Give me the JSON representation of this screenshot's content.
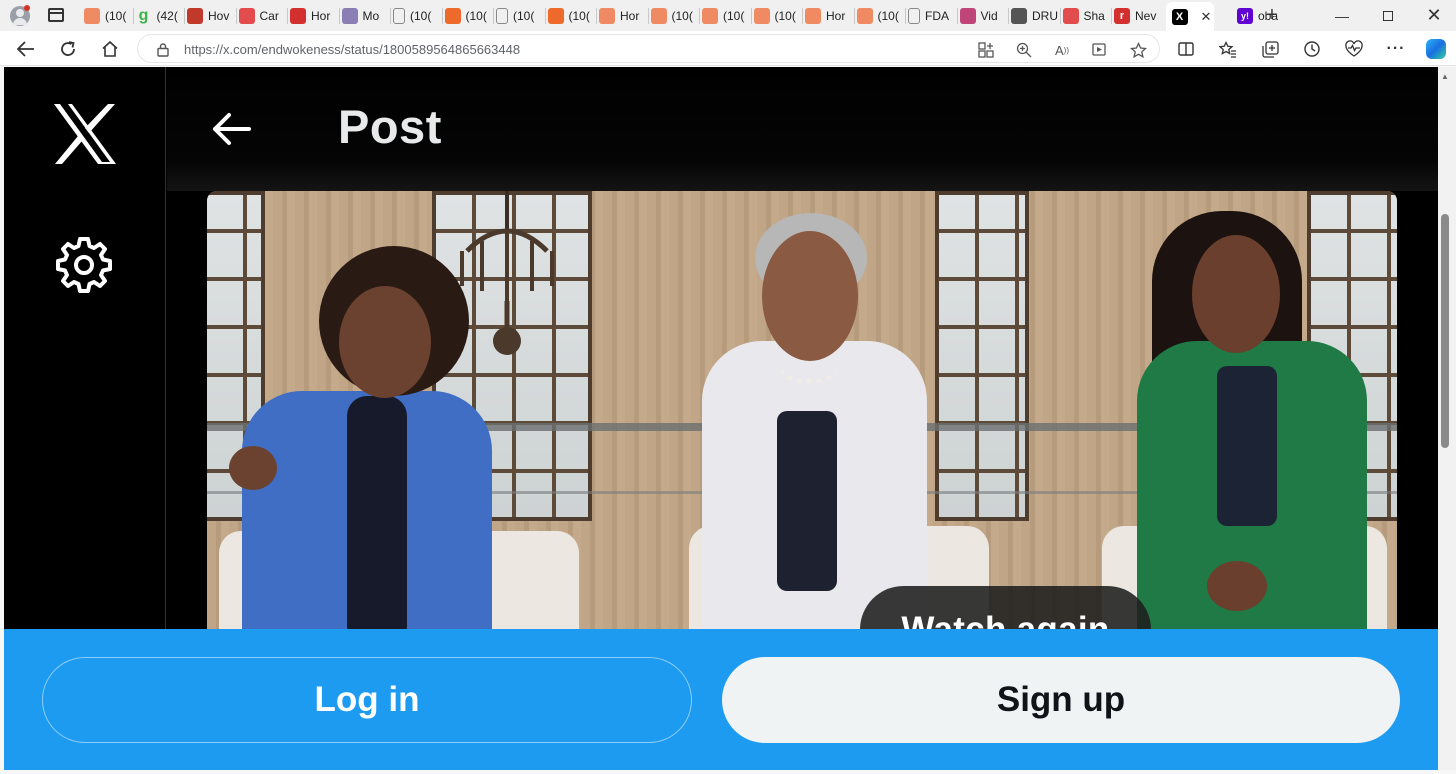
{
  "browser": {
    "tabs": [
      {
        "label": "(10(",
        "icon": "substack-icon",
        "color": "#f08a62"
      },
      {
        "label": "(42(",
        "icon": "green-g-icon",
        "color": "#3bb54a"
      },
      {
        "label": "Hov",
        "icon": "bi-icon",
        "color": "#c0392b"
      },
      {
        "label": "Car",
        "icon": "youtube-icon",
        "color": "#e34c4c"
      },
      {
        "label": "Hor",
        "icon": "red-shield-icon",
        "color": "#d32f2f"
      },
      {
        "label": "Mo",
        "icon": "ai-icon",
        "color": "#8a7fb5"
      },
      {
        "label": "(10(",
        "icon": "document-icon",
        "color": "#888888"
      },
      {
        "label": "(10(",
        "icon": "substack-icon",
        "color": "#ee6a2b"
      },
      {
        "label": "(10(",
        "icon": "document-icon",
        "color": "#888888"
      },
      {
        "label": "(10(",
        "icon": "substack-icon",
        "color": "#ee6a2b"
      },
      {
        "label": "Hor",
        "icon": "substack-icon",
        "color": "#f08a62"
      },
      {
        "label": "(10(",
        "icon": "substack-icon",
        "color": "#f08a62"
      },
      {
        "label": "(10(",
        "icon": "substack-icon",
        "color": "#f08a62"
      },
      {
        "label": "(10(",
        "icon": "substack-icon",
        "color": "#f08a62"
      },
      {
        "label": "Hor",
        "icon": "substack-icon",
        "color": "#f08a62"
      },
      {
        "label": "(10(",
        "icon": "substack-icon",
        "color": "#f08a62"
      },
      {
        "label": "FDA",
        "icon": "document-icon",
        "color": "#888888"
      },
      {
        "label": "Vid",
        "icon": "star-icon",
        "color": "#c0467a"
      },
      {
        "label": "DRU",
        "icon": "dr-icon",
        "color": "#555555"
      },
      {
        "label": "Sha",
        "icon": "youtube-icon",
        "color": "#e34c4c"
      },
      {
        "label": "Nev",
        "icon": "r-icon",
        "color": "#d32f2f"
      },
      {
        "label": "",
        "icon": "x-icon",
        "color": "#000000"
      },
      {
        "label": "oba",
        "icon": "yahoo-icon",
        "color": "#6001d2"
      }
    ],
    "url": "https://x.com/endwokeness/status/1800589564865663448"
  },
  "page": {
    "header_title": "Post",
    "video_overlay_label": "Watch again",
    "login_label": "Log in",
    "signup_label": "Sign up"
  },
  "colors": {
    "brand_blue": "#1d9bf0",
    "background": "#000000",
    "signup_bg": "#eff3f4"
  }
}
